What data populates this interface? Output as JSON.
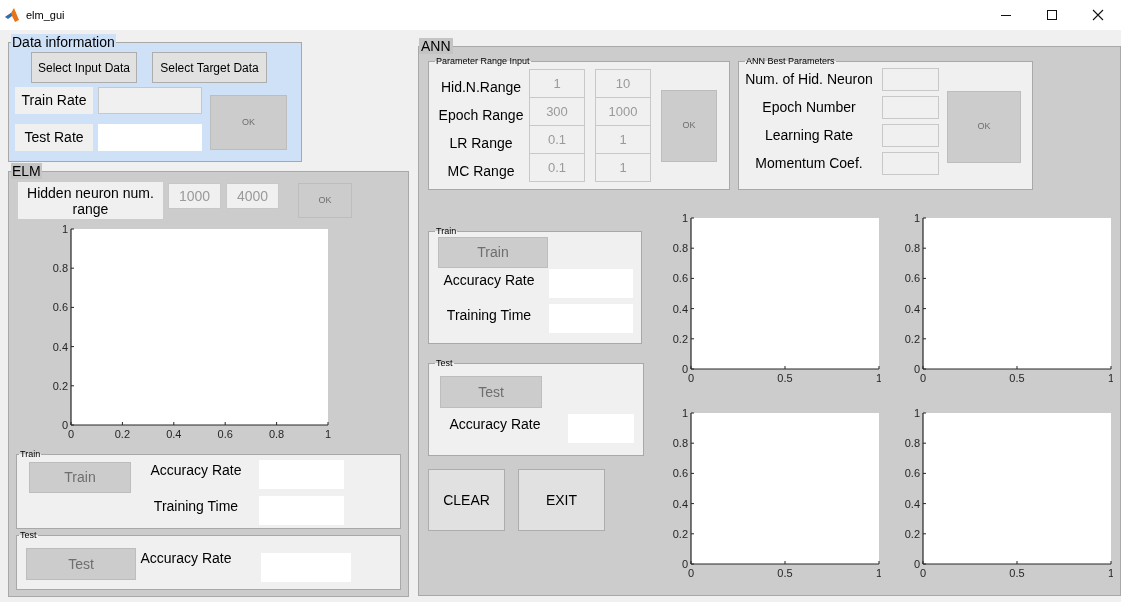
{
  "window": {
    "title": "elm_gui"
  },
  "data_information": {
    "title": "Data information",
    "buttons": [
      {
        "label": "Select Input Data",
        "disabled": false
      },
      {
        "label": "Select Target Data",
        "disabled": false
      }
    ],
    "fields": [
      {
        "label": "Train Rate",
        "disabled": true
      },
      {
        "label": "Test Rate",
        "disabled": false
      }
    ],
    "ok": {
      "label": "OK",
      "disabled": true
    }
  },
  "elm": {
    "title": "ELM",
    "hidden_neuron": {
      "label": "Hidden neuron num. range",
      "min": "1000",
      "max": "4000",
      "disabled": true
    },
    "ok": {
      "label": "OK",
      "disabled": true
    },
    "chart_data": {
      "type": "line",
      "xlim": [
        0,
        1
      ],
      "ylim": [
        0,
        1
      ],
      "xticks": [
        0,
        0.2,
        0.4,
        0.6,
        0.8,
        1
      ],
      "yticks": [
        0,
        0.2,
        0.4,
        0.6,
        0.8,
        1
      ]
    },
    "train": {
      "title": "Train",
      "button": {
        "label": "Train",
        "disabled": true
      },
      "fields": [
        {
          "label": "Accuracy Rate",
          "disabled": false
        },
        {
          "label": "Training Time",
          "disabled": false
        }
      ]
    },
    "test": {
      "title": "Test",
      "button": {
        "label": "Test",
        "disabled": true
      },
      "fields": [
        {
          "label": "Accuracy Rate",
          "disabled": false
        }
      ]
    }
  },
  "ann": {
    "title": "ANN",
    "parameter_range_input": {
      "title": "Parameter Range Input",
      "disabled": true,
      "rows": [
        {
          "label": "Hid.N.Range",
          "min": "1",
          "max": "10"
        },
        {
          "label": "Epoch Range",
          "min": "300",
          "max": "1000"
        },
        {
          "label": "LR Range",
          "min": "0.1",
          "max": "1"
        },
        {
          "label": "MC Range",
          "min": "0.1",
          "max": "1"
        }
      ],
      "ok": {
        "label": "OK",
        "disabled": true
      }
    },
    "best_parameters": {
      "title": "ANN Best Parameters",
      "disabled": true,
      "rows": [
        {
          "label": "Num. of Hid. Neuron"
        },
        {
          "label": "Epoch Number"
        },
        {
          "label": "Learning Rate"
        },
        {
          "label": "Momentum Coef."
        }
      ],
      "ok": {
        "label": "OK",
        "disabled": true
      }
    },
    "train": {
      "title": "Train",
      "button": {
        "label": "Train",
        "disabled": true
      },
      "fields": [
        {
          "label": "Accuracy Rate",
          "disabled": false
        },
        {
          "label": "Training Time",
          "disabled": false
        }
      ]
    },
    "test": {
      "title": "Test",
      "button": {
        "label": "Test",
        "disabled": true
      },
      "fields": [
        {
          "label": "Accuracy Rate",
          "disabled": false
        }
      ]
    },
    "buttons": [
      {
        "label": "CLEAR",
        "disabled": false
      },
      {
        "label": "EXIT",
        "disabled": false
      }
    ],
    "charts": [
      {
        "chart_data": {
          "type": "line",
          "xlim": [
            0,
            1
          ],
          "ylim": [
            0,
            1
          ],
          "xticks": [
            0,
            0.5,
            1
          ],
          "yticks": [
            0,
            0.2,
            0.4,
            0.6,
            0.8,
            1
          ]
        }
      },
      {
        "chart_data": {
          "type": "line",
          "xlim": [
            0,
            1
          ],
          "ylim": [
            0,
            1
          ],
          "xticks": [
            0,
            0.5,
            1
          ],
          "yticks": [
            0,
            0.2,
            0.4,
            0.6,
            0.8,
            1
          ]
        }
      },
      {
        "chart_data": {
          "type": "line",
          "xlim": [
            0,
            1
          ],
          "ylim": [
            0,
            1
          ],
          "xticks": [
            0,
            0.5,
            1
          ],
          "yticks": [
            0,
            0.2,
            0.4,
            0.6,
            0.8,
            1
          ]
        }
      },
      {
        "chart_data": {
          "type": "line",
          "xlim": [
            0,
            1
          ],
          "ylim": [
            0,
            1
          ],
          "xticks": [
            0,
            0.5,
            1
          ],
          "yticks": [
            0,
            0.2,
            0.4,
            0.6,
            0.8,
            1
          ]
        }
      }
    ]
  }
}
